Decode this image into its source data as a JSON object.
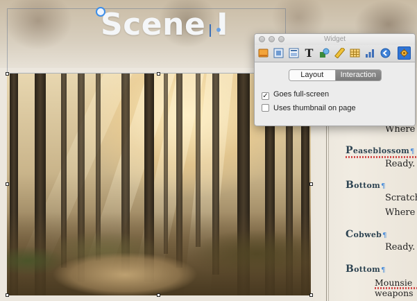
{
  "scene": {
    "title": "Scene I"
  },
  "image": {
    "description_icon": "forest-photo"
  },
  "script": {
    "fragments": [
      {
        "kind": "line",
        "text": "Where"
      },
      {
        "kind": "speaker",
        "first": "P",
        "rest": "easeblossom"
      },
      {
        "kind": "line",
        "text": "Ready."
      },
      {
        "kind": "speaker",
        "first": "B",
        "rest": "ottom"
      },
      {
        "kind": "line",
        "text": "Scratch"
      },
      {
        "kind": "line",
        "text": "Where"
      },
      {
        "kind": "speaker",
        "first": "C",
        "rest": "obweb"
      },
      {
        "kind": "line",
        "text": "Ready."
      },
      {
        "kind": "speaker",
        "first": "B",
        "rest": "ottom"
      },
      {
        "kind": "line",
        "text": "Mounsie"
      },
      {
        "kind": "line",
        "text": "weapons"
      }
    ],
    "pilcrow": "¶",
    "line_pilcrow": "¶"
  },
  "widget": {
    "title": "Widget",
    "tools": [
      {
        "icon": "image-widget-icon"
      },
      {
        "icon": "gallery-widget-icon"
      },
      {
        "icon": "frame-widget-icon"
      },
      {
        "icon": "text-widget-icon",
        "glyph": "T"
      },
      {
        "icon": "shape-widget-icon"
      },
      {
        "icon": "ruler-widget-icon"
      },
      {
        "icon": "table-widget-icon"
      },
      {
        "icon": "chart-widget-icon"
      },
      {
        "icon": "back-navigation-icon"
      },
      {
        "icon": "gear-settings-icon"
      }
    ],
    "active_tool": "gear-settings-icon",
    "tabs": {
      "layout": "Layout",
      "interaction": "Interaction",
      "selected": "Interaction"
    },
    "options": [
      {
        "label": "Goes full-screen",
        "checked": true,
        "mark": "✓"
      },
      {
        "label": "Uses thumbnail on page",
        "checked": false,
        "mark": ""
      }
    ]
  },
  "colors": {
    "speaker": "#2e4452",
    "pilcrow": "#4d8ed9",
    "selection_accent": "#2f74d6"
  }
}
